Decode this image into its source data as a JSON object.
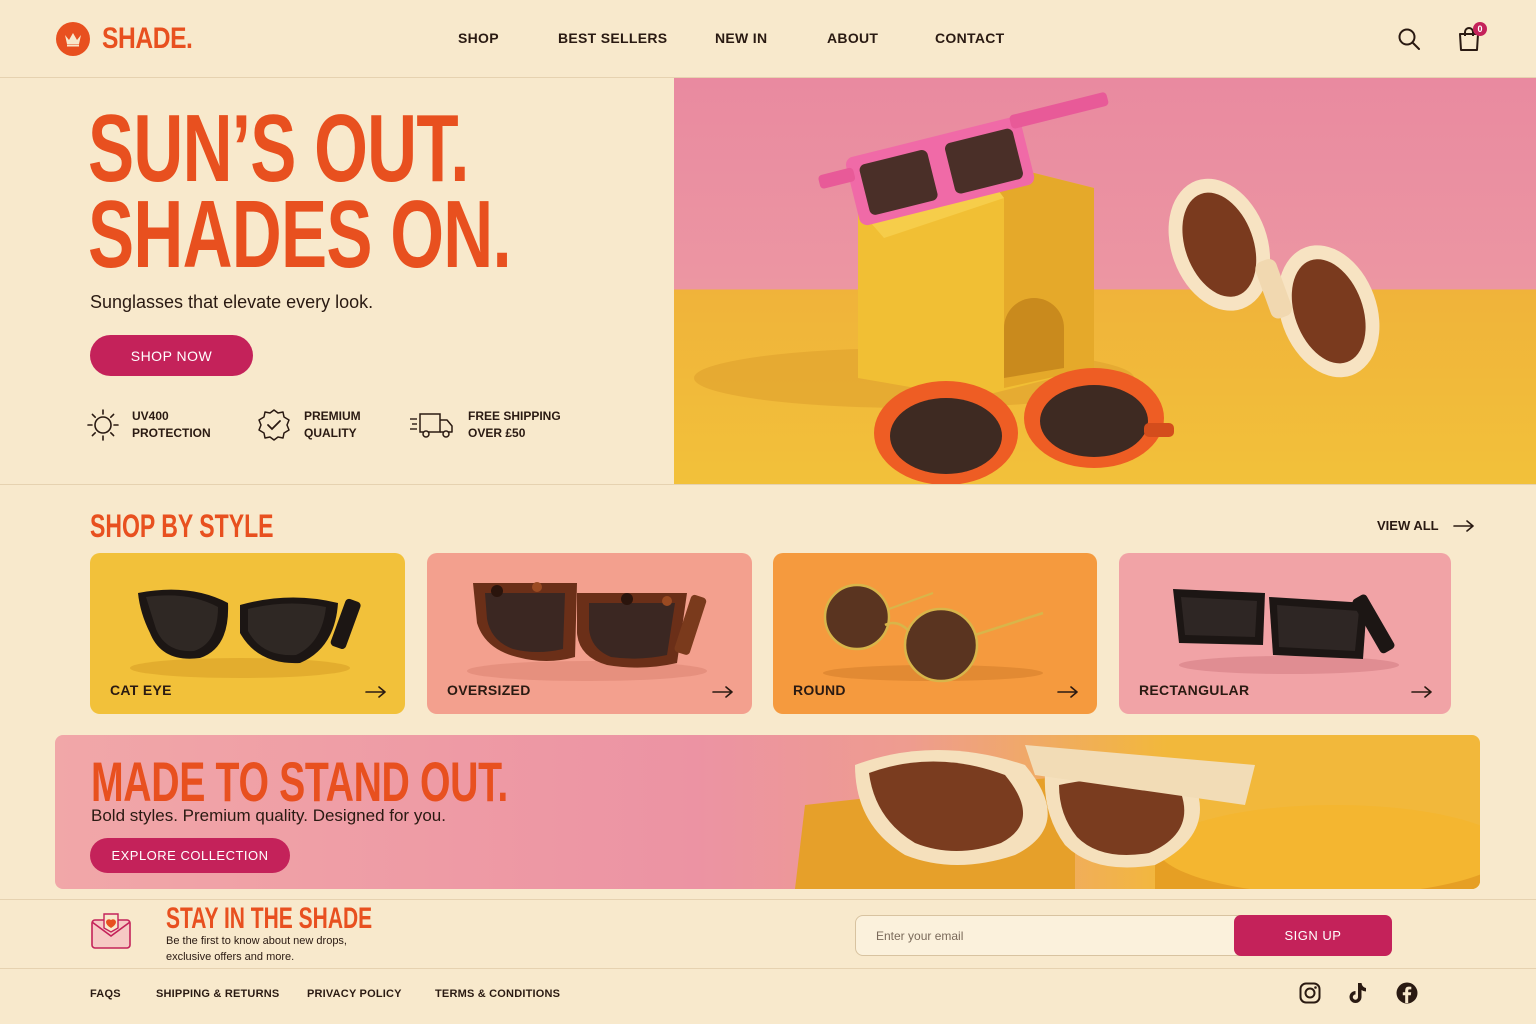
{
  "brand": {
    "name": "SHADE.",
    "accent": "#e8501f",
    "button": "#c4225a",
    "background": "#f8e9cc"
  },
  "nav": {
    "items": [
      "SHOP",
      "BEST SELLERS",
      "NEW IN",
      "ABOUT",
      "CONTACT"
    ],
    "cart_count": "0",
    "icons": [
      "search-icon",
      "bag-icon"
    ]
  },
  "hero": {
    "title_line1": "SUN’S OUT.",
    "title_line2": "SHADES ON.",
    "subtitle": "Sunglasses that elevate every look.",
    "cta": "SHOP NOW",
    "features": [
      {
        "icon": "sun-icon",
        "line1": "UV400",
        "line2": "PROTECTION"
      },
      {
        "icon": "quality-badge-icon",
        "line1": "PREMIUM",
        "line2": "QUALITY"
      },
      {
        "icon": "truck-icon",
        "line1": "FREE SHIPPING",
        "line2": "OVER £50"
      }
    ]
  },
  "styles": {
    "title": "SHOP BY STYLE",
    "view_all": "VIEW ALL",
    "cards": [
      {
        "label": "CAT EYE",
        "color": "#f2c13a"
      },
      {
        "label": "OVERSIZED",
        "color": "#f3a08e"
      },
      {
        "label": "ROUND",
        "color": "#f59a3e"
      },
      {
        "label": "RECTANGULAR",
        "color": "#f1a3a6"
      }
    ]
  },
  "banner": {
    "title": "MADE TO STAND OUT.",
    "subtitle": "Bold styles. Premium quality. Designed for you.",
    "cta": "EXPLORE COLLECTION"
  },
  "newsletter": {
    "title": "STAY IN THE SHADE",
    "line1": "Be the first to know about new drops,",
    "line2": "exclusive offers and more.",
    "placeholder": "Enter your email",
    "cta": "SIGN UP"
  },
  "footer": {
    "links": [
      "FAQS",
      "SHIPPING & RETURNS",
      "PRIVACY POLICY",
      "TERMS & CONDITIONS"
    ],
    "social": [
      "instagram-icon",
      "tiktok-icon",
      "facebook-icon"
    ]
  }
}
